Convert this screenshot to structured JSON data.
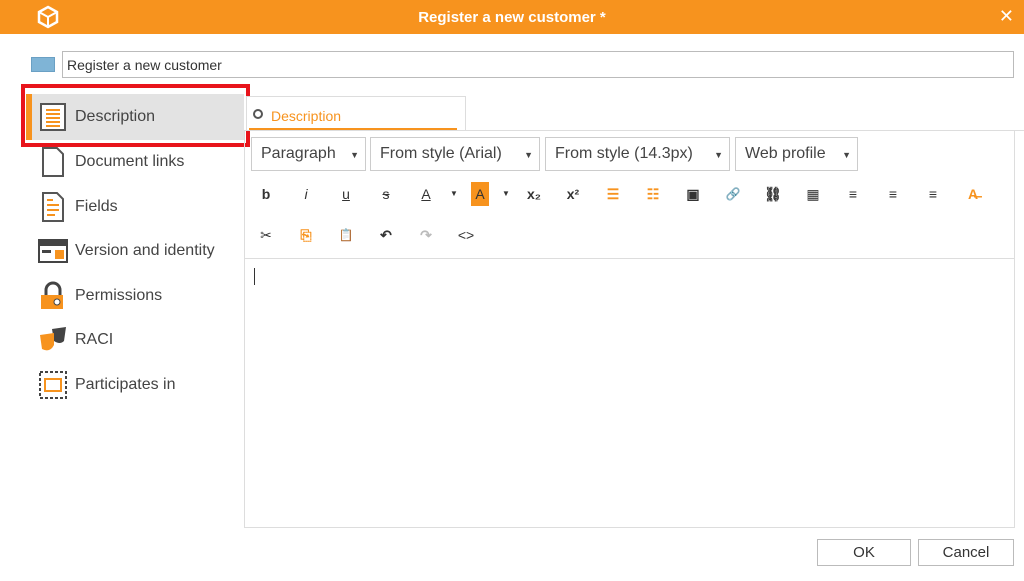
{
  "window": {
    "title": "Register a new customer *",
    "close_icon": "close-icon",
    "accent": "#f7931e"
  },
  "name_field": {
    "value": "Register a new customer"
  },
  "sidebar": {
    "items": [
      {
        "label": "Description",
        "icon": "description-icon",
        "active": true
      },
      {
        "label": "Document links",
        "icon": "document-icon"
      },
      {
        "label": "Fields",
        "icon": "fields-icon"
      },
      {
        "label": "Version and identity",
        "icon": "id-card-icon"
      },
      {
        "label": "Permissions",
        "icon": "lock-icon"
      },
      {
        "label": "RACI",
        "icon": "masks-icon"
      },
      {
        "label": "Participates in",
        "icon": "participates-icon"
      }
    ]
  },
  "tab": {
    "label": "Description"
  },
  "editor": {
    "selects": [
      "Paragraph",
      "From style (Arial)",
      "From style (14.3px)",
      "Web profile"
    ],
    "toolbar": {
      "bold": "b",
      "italic": "i",
      "underline": "u",
      "strike": "s",
      "font_color": "A",
      "highlight": "A",
      "subscript": "x₂",
      "superscript": "x²",
      "bullets": "☰",
      "numbers": "☷",
      "image": "▣",
      "link": "🔗",
      "unlink": "⛓",
      "table": "▦",
      "align_left": "≡",
      "align_center": "≡",
      "align_right": "≡",
      "clear_format": "A̶",
      "cut": "✂",
      "copy": "⎘",
      "paste": "📋",
      "undo": "↶",
      "redo": "↷",
      "source": "<>"
    },
    "content": ""
  },
  "footer": {
    "ok": "OK",
    "cancel": "Cancel"
  }
}
